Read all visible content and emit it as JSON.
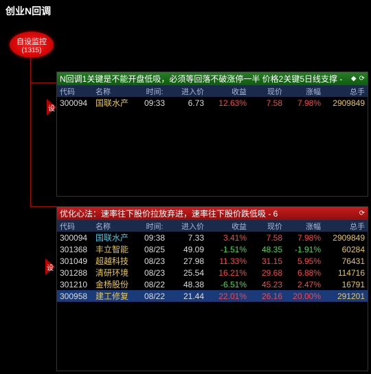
{
  "page_title": "创业N回调",
  "monitor": {
    "label": "自设监控",
    "count": "(1315)"
  },
  "tri_label": "设",
  "panels": [
    {
      "header_class": "green",
      "title": "N回调1关键是不能开盘低吸，必须等回落不破涨停一半 价格2关键5日线支撑 - ",
      "header_icons": [
        "◆",
        "⟳"
      ],
      "columns": [
        "代码",
        "名称",
        "时间:",
        "进入价",
        "收益",
        "现价",
        "涨幅",
        "总手"
      ],
      "rows": [
        {
          "hl": false,
          "code": "300094",
          "name": "国联水产",
          "name_c": "c-yellow",
          "time": "09:33",
          "entry": "6.73",
          "ret": "12.63%",
          "ret_c": "c-red",
          "price": "7.58",
          "price_c": "c-red",
          "chg": "7.98%",
          "chg_c": "c-red",
          "vol": "2909849"
        }
      ]
    },
    {
      "header_class": "red",
      "title": "优化心法：速率往下股价拉放弃进，速率往下股价跌低吸 - 6",
      "header_icons": [
        "⟳"
      ],
      "columns": [
        "代码",
        "名称",
        "时间:",
        "进入价",
        "收益",
        "现价",
        "涨幅",
        "总手"
      ],
      "rows": [
        {
          "hl": false,
          "code": "300094",
          "name": "国联水产",
          "name_c": "c-cyan",
          "time": "09:38",
          "entry": "7.33",
          "ret": "3.41%",
          "ret_c": "c-red",
          "price": "7.58",
          "price_c": "c-red",
          "chg": "7.98%",
          "chg_c": "c-red",
          "vol": "2909849"
        },
        {
          "hl": false,
          "code": "301368",
          "name": "丰立智能",
          "name_c": "c-yellow",
          "time": "08/25",
          "entry": "49.09",
          "ret": "-1.51%",
          "ret_c": "c-green",
          "price": "48.35",
          "price_c": "c-green",
          "chg": "-1.91%",
          "chg_c": "c-green",
          "vol": "60284"
        },
        {
          "hl": false,
          "code": "301049",
          "name": "超越科技",
          "name_c": "c-yellow",
          "time": "08/23",
          "entry": "27.98",
          "ret": "11.33%",
          "ret_c": "c-red",
          "price": "31.15",
          "price_c": "c-red",
          "chg": "5.95%",
          "chg_c": "c-red",
          "vol": "76431"
        },
        {
          "hl": false,
          "code": "301288",
          "name": "清研环境",
          "name_c": "c-yellow",
          "time": "08/23",
          "entry": "25.54",
          "ret": "16.21%",
          "ret_c": "c-red",
          "price": "29.68",
          "price_c": "c-red",
          "chg": "6.88%",
          "chg_c": "c-red",
          "vol": "114716"
        },
        {
          "hl": false,
          "code": "301210",
          "name": "金杨股份",
          "name_c": "c-yellow",
          "time": "08/22",
          "entry": "48.38",
          "ret": "-6.51%",
          "ret_c": "c-green",
          "price": "45.23",
          "price_c": "c-red",
          "chg": "2.47%",
          "chg_c": "c-red",
          "vol": "16791"
        },
        {
          "hl": true,
          "code": "300958",
          "name": "建工修复",
          "name_c": "c-yellow",
          "time": "08/22",
          "entry": "21.44",
          "ret": "22.01%",
          "ret_c": "c-red",
          "price": "26.16",
          "price_c": "c-red",
          "chg": "20.00%",
          "chg_c": "c-red",
          "vol": "291201"
        }
      ]
    }
  ]
}
